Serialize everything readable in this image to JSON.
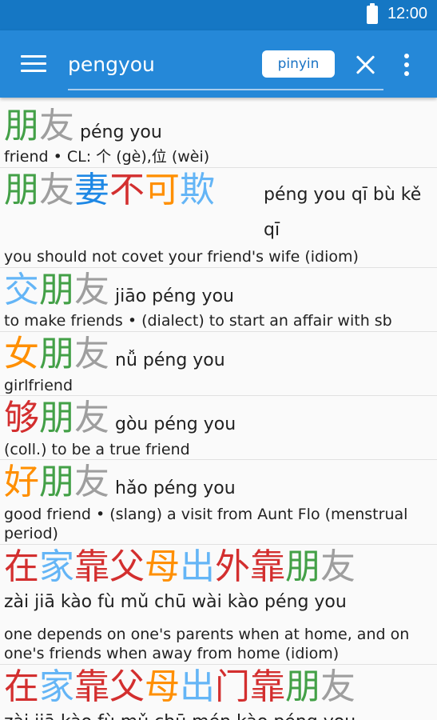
{
  "status_bar": {
    "time": "12:00",
    "battery_icon": "battery-full-icon"
  },
  "toolbar": {
    "menu_icon": "hamburger-menu-icon",
    "search": {
      "value": "pengyou"
    },
    "mode_button_label": "pinyin",
    "close_icon": "close-icon",
    "more_icon": "more-vert-icon"
  },
  "tone_colors": {
    "tone1": "#e53935",
    "tone2": "#43a047",
    "tone3": "#ff8f00",
    "tone4": "#1e88e5",
    "neutral": "#9e9e9e"
  },
  "entries": [
    {
      "chars": [
        "朋",
        "友"
      ],
      "pinyin": "péng you",
      "definition": "friend • CL: 个 (gè),位 (wèi)"
    },
    {
      "chars": [
        "朋",
        "友",
        "妻",
        "不",
        "可",
        "欺"
      ],
      "pinyin": "péng you qī bù kě qī",
      "definition": "you should not covet your friend's wife (idiom)"
    },
    {
      "chars": [
        "交",
        "朋",
        "友"
      ],
      "pinyin": "jiāo péng you",
      "definition": "to make friends • (dialect) to start an affair with sb"
    },
    {
      "chars": [
        "女",
        "朋",
        "友"
      ],
      "pinyin": "nǚ péng you",
      "definition": "girlfriend"
    },
    {
      "chars": [
        "够",
        "朋",
        "友"
      ],
      "pinyin": "gòu péng you",
      "definition": "(coll.) to be a true friend"
    },
    {
      "chars": [
        "好",
        "朋",
        "友"
      ],
      "pinyin": "hǎo péng you",
      "definition": "good friend • (slang) a visit from Aunt Flo (menstrual period)"
    },
    {
      "chars": [
        "在",
        "家",
        "靠",
        "父",
        "母",
        "出",
        "外",
        "靠",
        "朋",
        "友"
      ],
      "pinyin": "zài jiā kào fù mǔ chū wài kào péng you",
      "definition": "one depends on one's parents when at home, and on one's friends when away from home (idiom)"
    },
    {
      "chars": [
        "在",
        "家",
        "靠",
        "父",
        "母",
        "出",
        "门",
        "靠",
        "朋",
        "友"
      ],
      "pinyin": "zài jiā kào fù mǔ chū mén kào péng you",
      "definition": ""
    }
  ]
}
